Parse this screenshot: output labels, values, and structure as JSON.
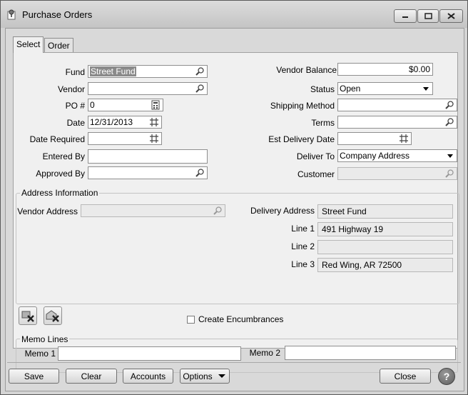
{
  "window": {
    "title": "Purchase Orders"
  },
  "tabs": [
    {
      "label": "Select",
      "active": true
    },
    {
      "label": "Order",
      "active": false
    }
  ],
  "left_form": {
    "fund": {
      "label": "Fund",
      "value": "Street Fund"
    },
    "vendor": {
      "label": "Vendor",
      "value": ""
    },
    "po_number": {
      "label": "PO #",
      "value": "0"
    },
    "date": {
      "label": "Date",
      "value": "12/31/2013"
    },
    "date_required": {
      "label": "Date Required",
      "value": ""
    },
    "entered_by": {
      "label": "Entered By",
      "value": ""
    },
    "approved_by": {
      "label": "Approved By",
      "value": ""
    }
  },
  "right_form": {
    "vendor_balance": {
      "label": "Vendor Balance",
      "value": "$0.00"
    },
    "status": {
      "label": "Status",
      "value": "Open"
    },
    "shipping_method": {
      "label": "Shipping Method",
      "value": ""
    },
    "terms": {
      "label": "Terms",
      "value": ""
    },
    "est_delivery_date": {
      "label": "Est Delivery Date",
      "value": ""
    },
    "deliver_to": {
      "label": "Deliver To",
      "value": "Company Address"
    },
    "customer": {
      "label": "Customer",
      "value": ""
    }
  },
  "address_info": {
    "group_label": "Address Information",
    "vendor_address": {
      "label": "Vendor Address",
      "value": ""
    },
    "delivery_address": {
      "label": "Delivery Address",
      "value": "Street Fund"
    },
    "line1": {
      "label": "Line 1",
      "value": "491 Highway 19"
    },
    "line2": {
      "label": "Line 2",
      "value": ""
    },
    "line3": {
      "label": "Line 3",
      "value": "Red Wing, AR  72500"
    }
  },
  "create_encumbrances": {
    "label": "Create Encumbrances",
    "checked": false
  },
  "memo_lines": {
    "group_label": "Memo Lines",
    "memo1": {
      "label": "Memo 1",
      "value": ""
    },
    "memo2": {
      "label": "Memo 2",
      "value": ""
    }
  },
  "buttons": {
    "save": "Save",
    "clear": "Clear",
    "accounts": "Accounts",
    "options": "Options",
    "close": "Close",
    "help": "?"
  },
  "icons": {
    "app": "document-pin-icon",
    "search": "magnifier-icon",
    "calendar": "calendar-icon",
    "action1": "delete-item-icon",
    "action2": "delete-mail-icon"
  }
}
